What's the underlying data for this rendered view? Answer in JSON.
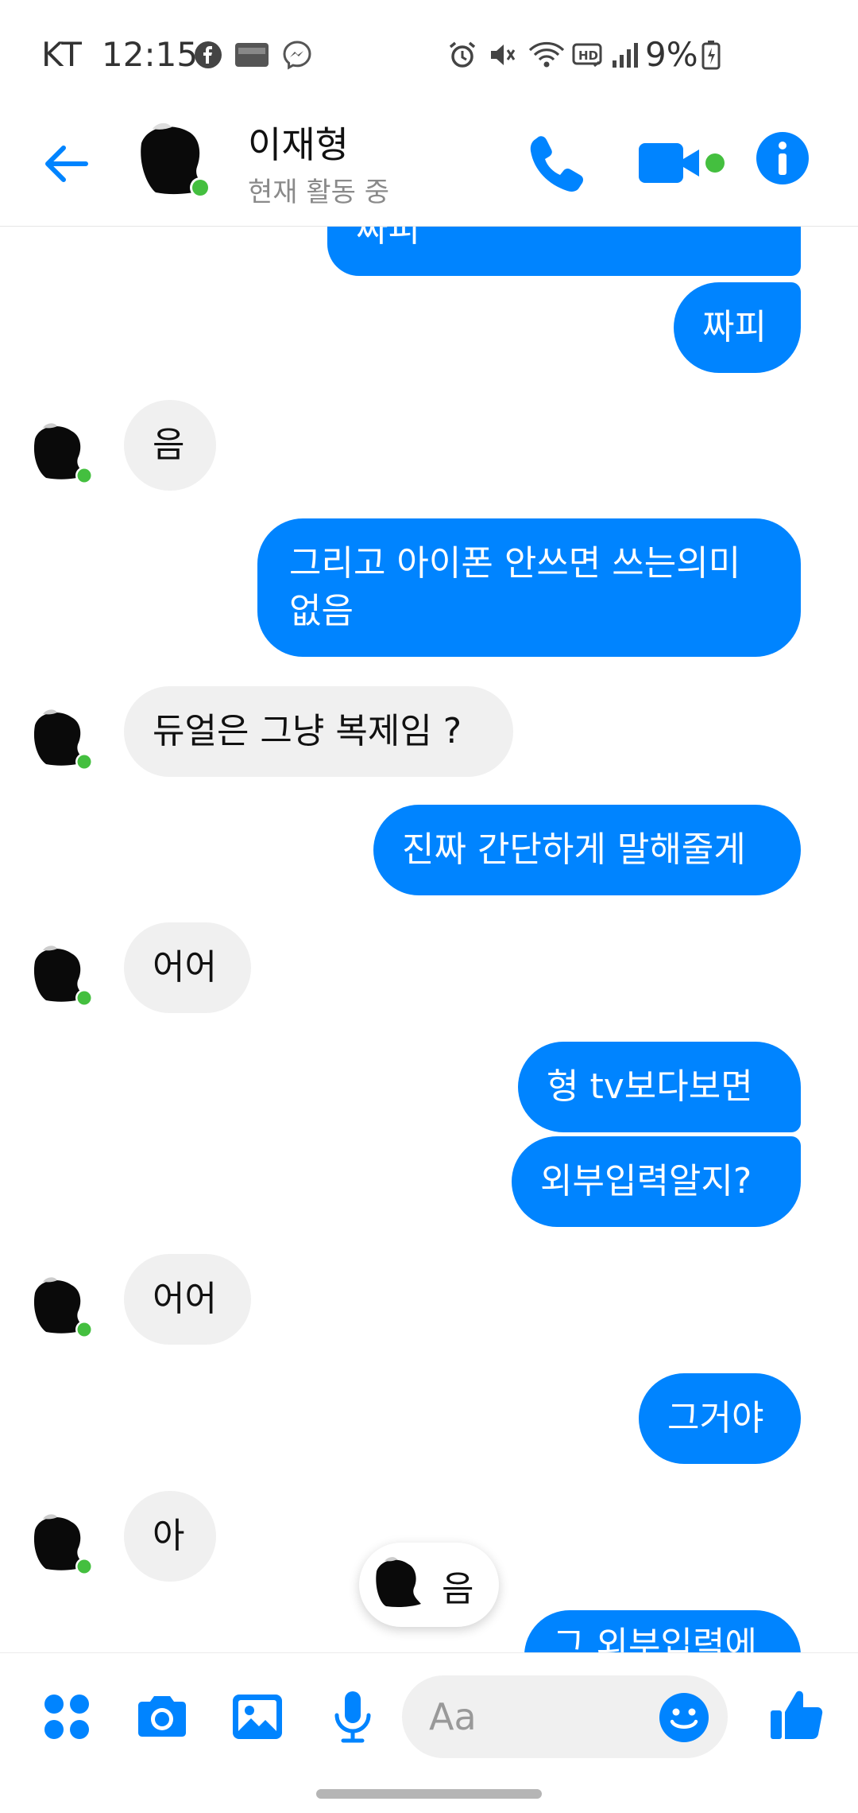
{
  "status_bar": {
    "carrier": "KT",
    "time": "12:15",
    "battery_text": "9%",
    "icons": [
      "facebook-icon",
      "tmoney-icon",
      "messenger-icon",
      "alarm-icon",
      "mute-icon",
      "wifi-icon",
      "hd-icon",
      "signal-icon",
      "battery-icon"
    ]
  },
  "header": {
    "contact_name": "이재형",
    "contact_status": "현재 활동 중",
    "accent_color": "#0084ff",
    "online_color": "#44bf3f"
  },
  "messages": [
    {
      "side": "out",
      "text": "짜피"
    },
    {
      "side": "out",
      "text": "짜피"
    },
    {
      "side": "in",
      "text": "음"
    },
    {
      "side": "out",
      "text": "그리고 아이폰 안쓰면 쓰는의미"
    },
    {
      "side": "out",
      "text": "없음"
    },
    {
      "side": "in",
      "text": "듀얼은 그냥 복제임 ?"
    },
    {
      "side": "out",
      "text": "진짜 간단하게 말해줄게"
    },
    {
      "side": "in",
      "text": "어어"
    },
    {
      "side": "out",
      "text": "형 tv보다보면"
    },
    {
      "side": "out",
      "text": "외부입력알지?"
    },
    {
      "side": "in",
      "text": "어어"
    },
    {
      "side": "out",
      "text": "그거야"
    },
    {
      "side": "in",
      "text": "아"
    },
    {
      "side": "out",
      "text": "그 외부입력에"
    }
  ],
  "typing_pill": {
    "text": "음"
  },
  "composer": {
    "placeholder": "Aa"
  }
}
